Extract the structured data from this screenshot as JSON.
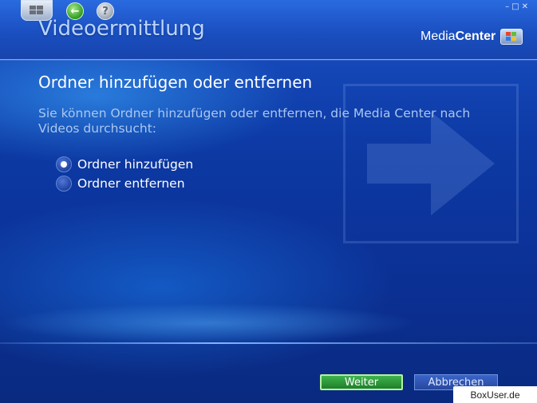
{
  "window": {
    "title": "Videoermittlung",
    "controls": [
      "–",
      "□",
      "✕"
    ]
  },
  "nav": {
    "start_button": "windows-start-icon",
    "back_button": "back-arrow-icon",
    "help_button": "help-icon"
  },
  "brand": {
    "prefix": "Media",
    "suffix": "Center"
  },
  "page": {
    "heading": "Ordner hinzufügen oder entfernen",
    "description": "Sie können Ordner hinzufügen oder entfernen, die Media Center nach Videos durchsucht:"
  },
  "options": [
    {
      "label": "Ordner hinzufügen",
      "selected": true
    },
    {
      "label": "Ordner entfernen",
      "selected": false
    }
  ],
  "buttons": {
    "next": "Weiter",
    "cancel": "Abbrechen"
  },
  "watermark": "BoxUser.de",
  "colors": {
    "background": "#0d3aa5",
    "header": "#1a4fc0",
    "next_button": "#2a9a38",
    "cancel_button": "#3258b8",
    "description_text": "#a9c7f0"
  }
}
